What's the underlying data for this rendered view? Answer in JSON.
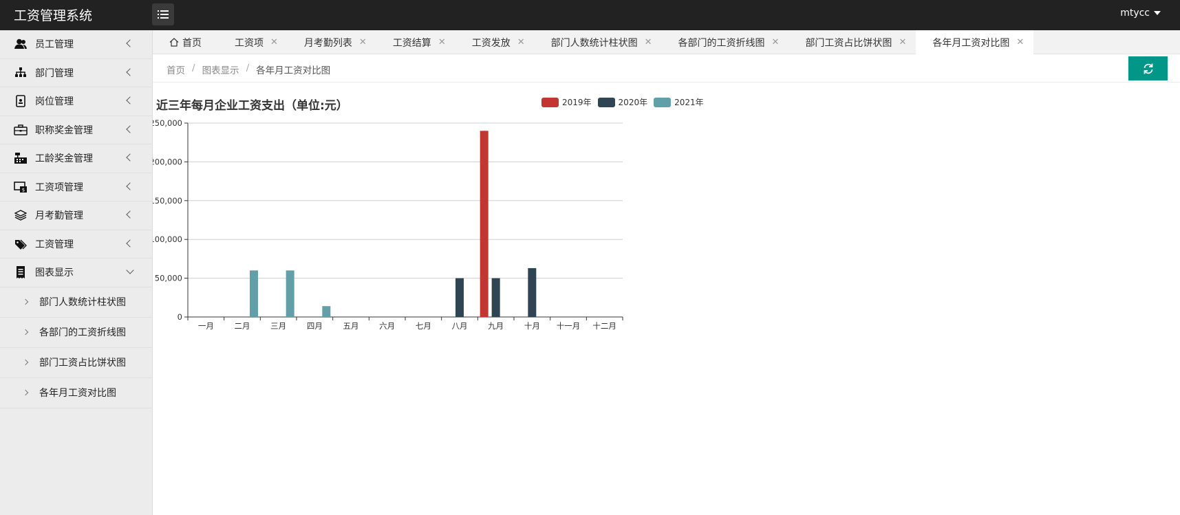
{
  "app": {
    "title": "工资管理系统",
    "user": "mtycc"
  },
  "sidebar": {
    "items": [
      {
        "label": "员工管理",
        "icon": "users-icon"
      },
      {
        "label": "部门管理",
        "icon": "sitemap-icon"
      },
      {
        "label": "岗位管理",
        "icon": "badge-icon"
      },
      {
        "label": "职称奖金管理",
        "icon": "briefcase-icon"
      },
      {
        "label": "工龄奖金管理",
        "icon": "cash-register-icon"
      },
      {
        "label": "工资项管理",
        "icon": "money-screen-icon"
      },
      {
        "label": "月考勤管理",
        "icon": "layers-icon"
      },
      {
        "label": "工资管理",
        "icon": "tags-icon"
      },
      {
        "label": "图表显示",
        "icon": "receipt-icon"
      }
    ],
    "subitems": [
      {
        "label": "部门人数统计柱状图"
      },
      {
        "label": "各部门的工资折线图"
      },
      {
        "label": "部门工资占比饼状图"
      },
      {
        "label": "各年月工资对比图"
      }
    ]
  },
  "tabs": [
    {
      "label": "首页"
    },
    {
      "label": "工资项"
    },
    {
      "label": "月考勤列表"
    },
    {
      "label": "工资结算"
    },
    {
      "label": "工资发放"
    },
    {
      "label": "部门人数统计柱状图"
    },
    {
      "label": "各部门的工资折线图"
    },
    {
      "label": "部门工资占比饼状图"
    },
    {
      "label": "各年月工资对比图"
    }
  ],
  "breadcrumb": {
    "home": "首页",
    "section": "图表显示",
    "current": "各年月工资对比图",
    "sep": "/"
  },
  "chart_data": {
    "type": "bar",
    "title": "近三年每月企业工资支出（单位:元）",
    "categories": [
      "一月",
      "二月",
      "三月",
      "四月",
      "五月",
      "六月",
      "七月",
      "八月",
      "九月",
      "十月",
      "十一月",
      "十二月"
    ],
    "series": [
      {
        "name": "2019年",
        "color": "#c23531",
        "values": [
          0,
          0,
          0,
          0,
          0,
          0,
          0,
          0,
          240000,
          0,
          0,
          0
        ]
      },
      {
        "name": "2020年",
        "color": "#2f4554",
        "values": [
          0,
          0,
          0,
          0,
          0,
          0,
          0,
          50000,
          50000,
          63000,
          0,
          0
        ]
      },
      {
        "name": "2021年",
        "color": "#61a0a8",
        "values": [
          0,
          60000,
          60000,
          14000,
          0,
          0,
          0,
          0,
          0,
          0,
          0,
          0
        ]
      }
    ],
    "ylim": [
      0,
      250000
    ],
    "yticks": [
      "0",
      "50,000",
      "100,000",
      "150,000",
      "200,000",
      "250,000"
    ],
    "legend_position": "top-right",
    "grid": true
  }
}
